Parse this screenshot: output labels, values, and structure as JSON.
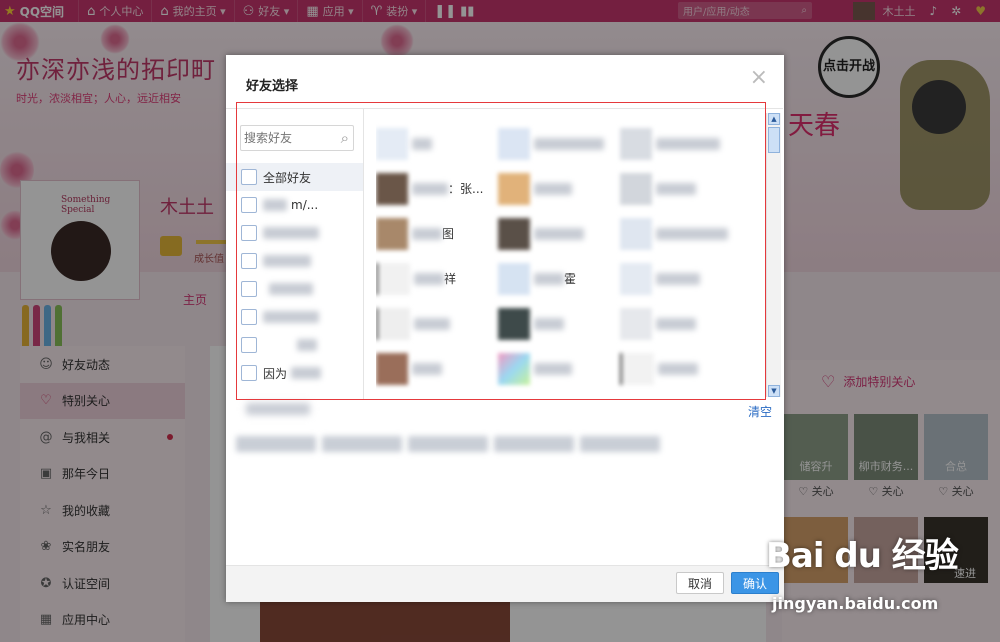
{
  "topbar": {
    "logo": "QQ空间",
    "items": [
      "个人中心",
      "我的主页",
      "好友",
      "应用",
      "装扮"
    ],
    "search_placeholder": "用户/应用/动态",
    "user_name": "木土土"
  },
  "profile": {
    "blog_title": "亦深亦浅的拓印町",
    "blog_subtitle": "时光，浓淡相宜；人心，远近相安",
    "owner_name": "木土土",
    "level_label": "成长值",
    "avatar_caption": "Something Special",
    "main_tab": "主页"
  },
  "left_nav": {
    "items": [
      {
        "label": "好友动态",
        "icon": "user-icon"
      },
      {
        "label": "特别关心",
        "icon": "heart-icon"
      },
      {
        "label": "与我相关",
        "icon": "at-icon"
      },
      {
        "label": "那年今日",
        "icon": "calendar-icon"
      },
      {
        "label": "我的收藏",
        "icon": "star-icon"
      },
      {
        "label": "实名朋友",
        "icon": "friends-icon"
      },
      {
        "label": "认证空间",
        "icon": "certified-icon"
      },
      {
        "label": "应用中心",
        "icon": "apps-icon"
      }
    ]
  },
  "right_panel": {
    "game_badge": "点击开战",
    "spring_text": "天春",
    "special_button": "添加特别关心",
    "friends": [
      {
        "name": "储容升",
        "care": "关心"
      },
      {
        "name": "柳市财务...",
        "care": "关心"
      },
      {
        "name": "合总",
        "care": "关心"
      }
    ],
    "friends2_caption": "速进"
  },
  "dialog": {
    "title": "好友选择",
    "close": "×",
    "search_placeholder": "搜索好友",
    "groups": [
      {
        "label": "全部好友"
      },
      {
        "label": "m/..."
      },
      {
        "label": ""
      },
      {
        "label": ""
      },
      {
        "label": ""
      },
      {
        "label": ""
      },
      {
        "label": ""
      },
      {
        "label": "因为"
      }
    ],
    "friends": [
      {
        "name": ""
      },
      {
        "name": ""
      },
      {
        "name": ""
      },
      {
        "name": "：张..."
      },
      {
        "name": ""
      },
      {
        "name": ""
      },
      {
        "name": "图"
      },
      {
        "name": ""
      },
      {
        "name": ""
      },
      {
        "name": "祥"
      },
      {
        "name": "霍"
      },
      {
        "name": ""
      },
      {
        "name": ""
      },
      {
        "name": ""
      },
      {
        "name": ""
      },
      {
        "name": ""
      },
      {
        "name": ""
      },
      {
        "name": ""
      }
    ],
    "clear_label": "清空",
    "cancel_label": "取消",
    "ok_label": "确认"
  },
  "watermark": {
    "logo": "Bai du 经验",
    "url": "jingyan.baidu.com"
  }
}
